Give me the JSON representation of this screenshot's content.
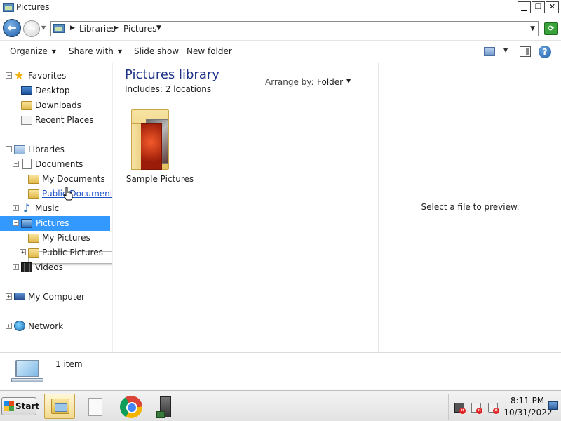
{
  "window": {
    "title": "Pictures",
    "minimize": "▁",
    "restore": "❐",
    "close": "✕"
  },
  "address": {
    "breadcrumbs": [
      "Libraries",
      "Pictures"
    ],
    "back_icon": "←",
    "forward_icon": "→"
  },
  "toolbar": {
    "organize": "Organize",
    "share_with": "Share with",
    "slide_show": "Slide show",
    "new_folder": "New folder"
  },
  "nav": {
    "favorites": "Favorites",
    "desktop": "Desktop",
    "downloads": "Downloads",
    "recent_places": "Recent Places",
    "libraries": "Libraries",
    "documents": "Documents",
    "my_documents": "My Documents",
    "public_documents": "Public Documents",
    "music": "Music",
    "pictures": "Pictures",
    "my_pictures": "My Pictures",
    "public_pictures": "Public Pictures",
    "videos": "Videos",
    "my_computer": "My Computer",
    "network": "Network",
    "collapse_glyph": "−",
    "expand_glyph": "+"
  },
  "content": {
    "library_title": "Pictures library",
    "includes_label": "Includes:",
    "includes_value": "2 locations",
    "arrange_label": "Arrange by:",
    "arrange_value": "Folder",
    "items": [
      {
        "name": "Sample Pictures",
        "icon": "folder-with-photos-icon"
      }
    ]
  },
  "preview": {
    "message": "Select a file to preview."
  },
  "details": {
    "item_count": "1 item"
  },
  "taskbar": {
    "start_label": "Start",
    "time": "8:11 PM",
    "date": "10/31/2022"
  },
  "colors": {
    "selection": "#3399ff",
    "library_title": "#1e3287",
    "link_hover": "#1a52c8"
  }
}
